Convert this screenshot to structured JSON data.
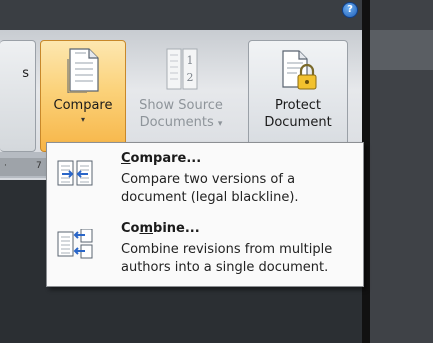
{
  "help": {
    "glyph": "?"
  },
  "ruler": {
    "marks": [
      "·",
      "7"
    ]
  },
  "ribbon": {
    "prev_button": {
      "label_fragment": "s"
    },
    "compare": {
      "label": "Compare",
      "arrow": "▾"
    },
    "show_source": {
      "line1": "Show Source",
      "line2": "Documents",
      "arrow": "▾"
    },
    "protect": {
      "line1": "Protect",
      "line2": "Document"
    }
  },
  "menu": {
    "items": [
      {
        "title_pre": "",
        "title_accel": "C",
        "title_post": "ompare...",
        "description": "Compare two versions of a document (legal blackline)."
      },
      {
        "title_pre": "Co",
        "title_accel": "m",
        "title_post": "bine...",
        "description": "Combine revisions from multiple authors into a single document."
      }
    ]
  },
  "colors": {
    "compare_highlight": "#f7b547",
    "menu_background": "#fafafa",
    "disabled_text": "#8e949a"
  }
}
